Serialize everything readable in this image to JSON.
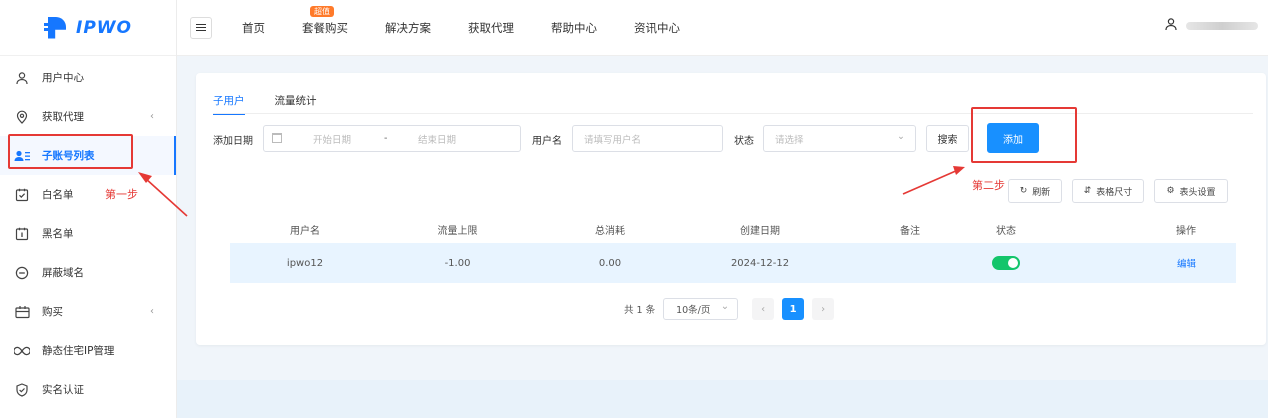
{
  "brand": {
    "name": "IPWO",
    "color": "#1677ff"
  },
  "sidebar": {
    "items": [
      {
        "icon": "user-icon",
        "label": "用户中心",
        "arrow": ""
      },
      {
        "icon": "location-icon",
        "label": "获取代理",
        "arrow": "‹"
      },
      {
        "icon": "account-list-icon",
        "label": "子账号列表",
        "arrow": "",
        "active": true
      },
      {
        "icon": "check-list-icon",
        "label": "白名单",
        "arrow": ""
      },
      {
        "icon": "block-list-icon",
        "label": "黑名单",
        "arrow": ""
      },
      {
        "icon": "minus-circle-icon",
        "label": "屏蔽域名",
        "arrow": ""
      },
      {
        "icon": "cart-icon",
        "label": "购买",
        "arrow": "‹"
      },
      {
        "icon": "infinity-icon",
        "label": "静态住宅IP管理",
        "arrow": ""
      },
      {
        "icon": "shield-check-icon",
        "label": "实名认证",
        "arrow": ""
      }
    ]
  },
  "annotations": {
    "step1": "第一步",
    "step2": "第二步",
    "color": "#e53935"
  },
  "topnav": {
    "items": [
      "首页",
      "套餐购买",
      "解决方案",
      "获取代理",
      "帮助中心",
      "资讯中心"
    ],
    "badge": "超值"
  },
  "main": {
    "tabs": [
      "子用户",
      "流量统计"
    ],
    "filter": {
      "date_label": "添加日期",
      "start_placeholder": "开始日期",
      "range_sep": "-",
      "end_placeholder": "结束日期",
      "username_label": "用户名",
      "username_placeholder": "请填写用户名",
      "status_label": "状态",
      "status_placeholder": "请选择",
      "search_label": "搜索",
      "add_label": "添加"
    },
    "tools": {
      "refresh": "刷新",
      "table_size": "表格尺寸",
      "header_settings": "表头设置"
    },
    "table": {
      "columns": [
        "用户名",
        "流量上限",
        "总消耗",
        "创建日期",
        "备注",
        "状态",
        "操作"
      ],
      "rows": [
        {
          "username": "ipwo12",
          "limit": "-1.00",
          "used": "0.00",
          "created": "2024-12-12",
          "note": "",
          "status": "on",
          "action": "编辑"
        }
      ]
    },
    "pagination": {
      "total": "共 1 条",
      "page_size": "10条/页",
      "prev": "‹",
      "current": "1",
      "next": "›"
    }
  }
}
